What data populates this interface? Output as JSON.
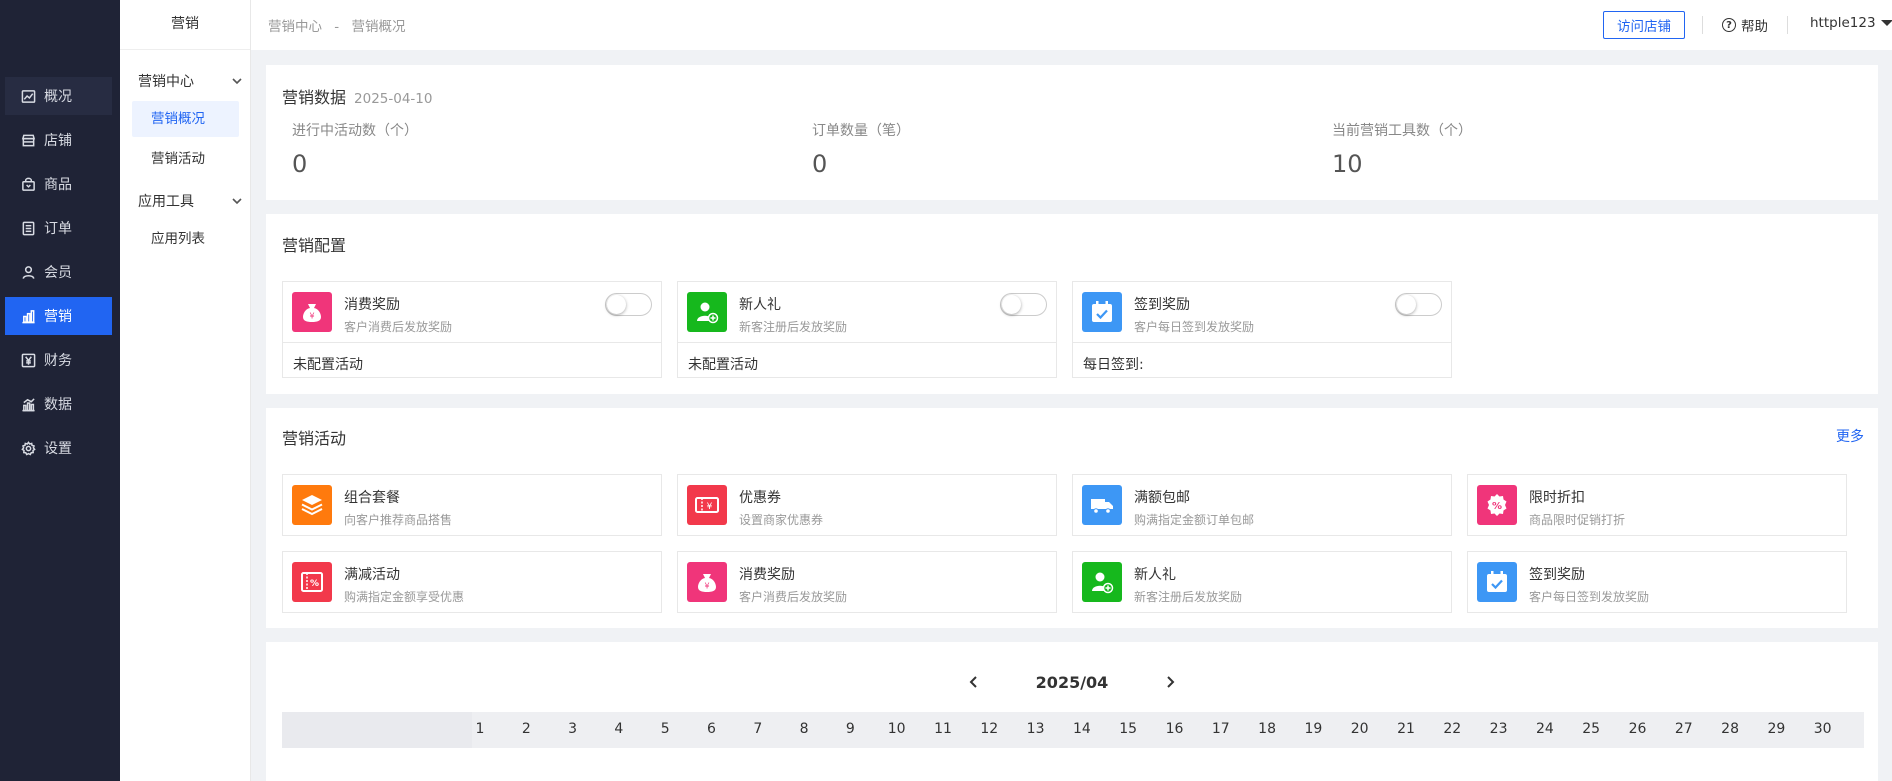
{
  "nav": {
    "items": [
      {
        "label": "概况",
        "icon": "overview-chart-icon"
      },
      {
        "label": "店铺",
        "icon": "store-icon"
      },
      {
        "label": "商品",
        "icon": "goods-bag-icon"
      },
      {
        "label": "订单",
        "icon": "order-list-icon"
      },
      {
        "label": "会员",
        "icon": "member-user-icon"
      },
      {
        "label": "营销",
        "icon": "marketing-bar-icon"
      },
      {
        "label": "财务",
        "icon": "finance-yuan-icon"
      },
      {
        "label": "数据",
        "icon": "data-chart-icon"
      },
      {
        "label": "设置",
        "icon": "settings-gear-icon"
      }
    ],
    "active_index": 5
  },
  "subnav": {
    "title": "营销",
    "group1": "营销中心",
    "item_overview": "营销概况",
    "item_activity": "营销活动",
    "group2": "应用工具",
    "item_applist": "应用列表"
  },
  "header": {
    "crumb1": "营销中心",
    "crumb_sep": "-",
    "crumb2": "营销概况",
    "visit_store": "访问店铺",
    "help": "帮助",
    "help_glyph": "?",
    "username": "httple123"
  },
  "stats": {
    "title": "营销数据",
    "date": "2025-04-10",
    "items": [
      {
        "label": "进行中活动数（个）",
        "value": "0"
      },
      {
        "label": "订单数量（笔）",
        "value": "0"
      },
      {
        "label": "当前营销工具数（个）",
        "value": "10"
      }
    ]
  },
  "config": {
    "title": "营销配置",
    "items": [
      {
        "name": "消费奖励",
        "desc": "客户消费后发放奖励",
        "status": "未配置活动",
        "enabled": false,
        "color": "#f0357a"
      },
      {
        "name": "新人礼",
        "desc": "新客注册后发放奖励",
        "status": "未配置活动",
        "enabled": false,
        "color": "#16b81d"
      },
      {
        "name": "签到奖励",
        "desc": "客户每日签到发放奖励",
        "status": "每日签到:",
        "enabled": false,
        "color": "#3d97f5"
      }
    ]
  },
  "activities": {
    "title": "营销活动",
    "more": "更多",
    "items": [
      {
        "name": "组合套餐",
        "desc": "向客户推荐商品搭售",
        "color": "#ff7a0d"
      },
      {
        "name": "优惠券",
        "desc": "设置商家优惠券",
        "color": "#f2394b"
      },
      {
        "name": "满额包邮",
        "desc": "购满指定金额订单包邮",
        "color": "#3d97f5"
      },
      {
        "name": "限时折扣",
        "desc": "商品限时促销打折",
        "color": "#f0357a"
      },
      {
        "name": "满减活动",
        "desc": "购满指定金额享受优惠",
        "color": "#f2394b"
      },
      {
        "name": "消费奖励",
        "desc": "客户消费后发放奖励",
        "color": "#f0357a"
      },
      {
        "name": "新人礼",
        "desc": "新客注册后发放奖励",
        "color": "#16b81d"
      },
      {
        "name": "签到奖励",
        "desc": "客户每日签到发放奖励",
        "color": "#3d97f5"
      }
    ]
  },
  "calendar": {
    "month": "2025/04",
    "days": [
      "1",
      "2",
      "3",
      "4",
      "5",
      "6",
      "7",
      "8",
      "9",
      "10",
      "11",
      "12",
      "13",
      "14",
      "15",
      "16",
      "17",
      "18",
      "19",
      "20",
      "21",
      "22",
      "23",
      "24",
      "25",
      "26",
      "27",
      "28",
      "29",
      "30"
    ]
  },
  "colors": {
    "nav_bg": "#1f2336",
    "accent": "#2165f2"
  }
}
